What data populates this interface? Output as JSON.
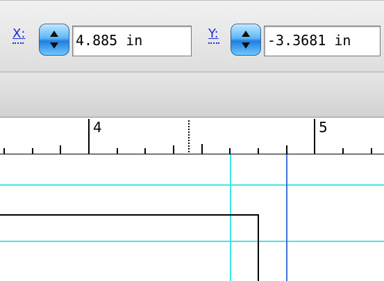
{
  "toolbar": {
    "x_field": {
      "label": "X:",
      "value": "4.885 in"
    },
    "y_field": {
      "label": "Y:",
      "value": "-3.3681 in"
    }
  },
  "ruler": {
    "labels": [
      "4",
      "5"
    ]
  },
  "colors": {
    "guide_cyan": "#3fe6e6",
    "guide_blue": "#3f73d8",
    "link_blue": "#1a2bd8",
    "stepper_blue": "#3a9cf0"
  },
  "icons": {
    "stepper": "up-down-arrows-icon"
  }
}
